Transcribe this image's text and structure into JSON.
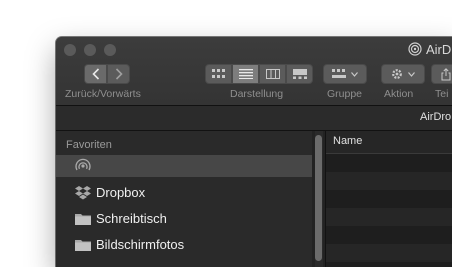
{
  "window": {
    "title": "AirDr",
    "path_title": "AirDro"
  },
  "toolbar": {
    "nav_label": "Zurück/Vorwärts",
    "view_label": "Darstellung",
    "group_label": "Gruppe",
    "action_label": "Aktion",
    "share_label": "Tei"
  },
  "sidebar": {
    "section": "Favoriten",
    "items": [
      {
        "label": "",
        "icon": "airdrop-icon"
      },
      {
        "label": "Dropbox",
        "icon": "dropbox-icon"
      },
      {
        "label": "Schreibtisch",
        "icon": "folder-icon"
      },
      {
        "label": "Bildschirmfotos",
        "icon": "folder-icon"
      }
    ]
  },
  "content": {
    "column_name": "Name"
  },
  "colors": {
    "window_bg": "#232323",
    "sidebar_bg": "#2a2a2a",
    "selected_bg": "#474747",
    "text": "#f0f0f0",
    "muted_text": "#9a9a9a",
    "folder": "#9fb6cc"
  }
}
